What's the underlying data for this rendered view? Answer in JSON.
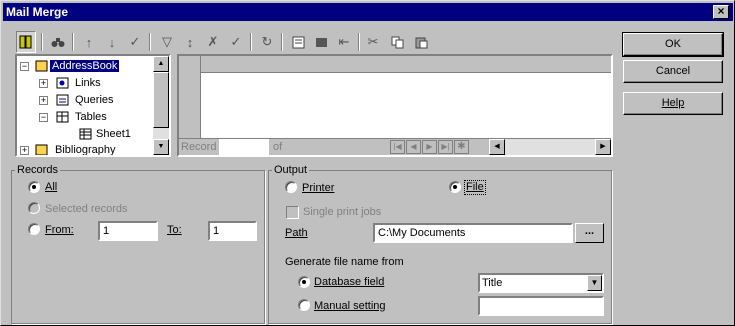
{
  "window": {
    "title": "Mail Merge",
    "close_glyph": "×"
  },
  "toolbar": {
    "icons": [
      "database-icon",
      "binoculars-icon",
      "sort-ascending-icon",
      "sort-descending-icon",
      "autofilter-icon",
      "filter-icon",
      "sort-icon",
      "remove-filter-icon",
      "apply-filter-icon",
      "refresh-icon",
      "form-icon",
      "table-icon",
      "insert-column-icon",
      "cut-icon",
      "copy-icon",
      "paste-icon"
    ]
  },
  "buttons": {
    "ok": "OK",
    "cancel": "Cancel",
    "help": "Help"
  },
  "tree": {
    "root": "AddressBook",
    "children": [
      "Links",
      "Queries",
      "Tables"
    ],
    "tables_children": [
      "Sheet1"
    ],
    "next_root": "Bibliography"
  },
  "grid": {
    "record_label": "Record",
    "record_value": "",
    "of_label": "of"
  },
  "records": {
    "legend": "Records",
    "all": "All",
    "selected": "Selected records",
    "from_label": "From:",
    "from_value": "1",
    "to_label": "To:",
    "to_value": "1",
    "selected_option": "all"
  },
  "output": {
    "legend": "Output",
    "printer": "Printer",
    "file": "File",
    "selected_option": "file",
    "single_print_jobs": "Single print jobs",
    "path_label": "Path",
    "path_value": "C:\\My Documents",
    "browse_label": "...",
    "generate_label": "Generate file name from",
    "database_field": "Database field",
    "database_field_value": "Title",
    "manual_setting": "Manual setting",
    "manual_setting_value": "",
    "filename_option": "database_field"
  }
}
